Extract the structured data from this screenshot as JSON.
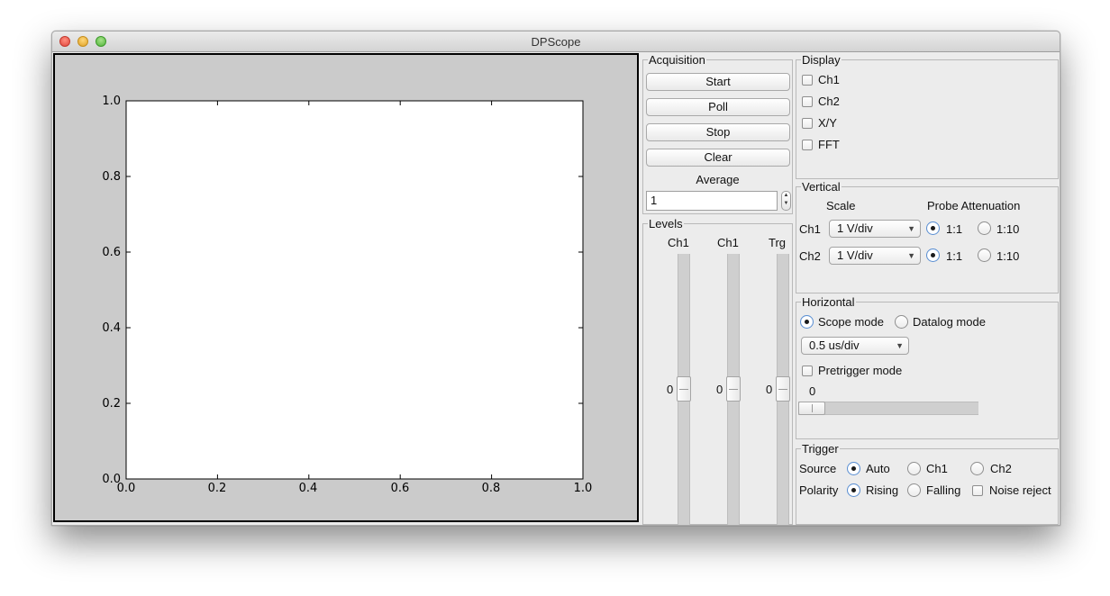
{
  "window": {
    "title": "DPScope"
  },
  "plot": {
    "x_ticks": [
      "0.0",
      "0.2",
      "0.4",
      "0.6",
      "0.8",
      "1.0"
    ],
    "y_ticks": [
      "0.0",
      "0.2",
      "0.4",
      "0.6",
      "0.8",
      "1.0"
    ]
  },
  "chart_data": {
    "type": "line",
    "x": [],
    "series": [],
    "xlim": [
      0.0,
      1.0
    ],
    "ylim": [
      0.0,
      1.0
    ],
    "x_ticks": [
      0.0,
      0.2,
      0.4,
      0.6,
      0.8,
      1.0
    ],
    "y_ticks": [
      0.0,
      0.2,
      0.4,
      0.6,
      0.8,
      1.0
    ],
    "grid": false
  },
  "acquisition": {
    "title": "Acquisition",
    "start": "Start",
    "poll": "Poll",
    "stop": "Stop",
    "clear": "Clear",
    "average_label": "Average",
    "average_value": "1"
  },
  "levels": {
    "title": "Levels",
    "sliders": [
      {
        "label": "Ch1",
        "value": "0"
      },
      {
        "label": "Ch1",
        "value": "0"
      },
      {
        "label": "Trg",
        "value": "0"
      }
    ]
  },
  "display": {
    "title": "Display",
    "options": [
      {
        "label": "Ch1",
        "checked": false
      },
      {
        "label": "Ch2",
        "checked": false
      },
      {
        "label": "X/Y",
        "checked": false
      },
      {
        "label": "FFT",
        "checked": false
      }
    ]
  },
  "vertical": {
    "title": "Vertical",
    "scale_header": "Scale",
    "probe_header": "Probe Attenuation",
    "ch1": {
      "label": "Ch1",
      "scale": "1 V/div",
      "att_a": "1:1",
      "att_b": "1:10"
    },
    "ch2": {
      "label": "Ch2",
      "scale": "1 V/div",
      "att_a": "1:1",
      "att_b": "1:10"
    }
  },
  "horizontal": {
    "title": "Horizontal",
    "scope_mode": "Scope mode",
    "datalog_mode": "Datalog mode",
    "timebase": "0.5 us/div",
    "pretrigger_label": "Pretrigger mode",
    "pretrigger_value": "0"
  },
  "trigger": {
    "title": "Trigger",
    "source_label": "Source",
    "source_auto": "Auto",
    "source_ch1": "Ch1",
    "source_ch2": "Ch2",
    "polarity_label": "Polarity",
    "polarity_rising": "Rising",
    "polarity_falling": "Falling",
    "noise_reject": "Noise reject"
  }
}
